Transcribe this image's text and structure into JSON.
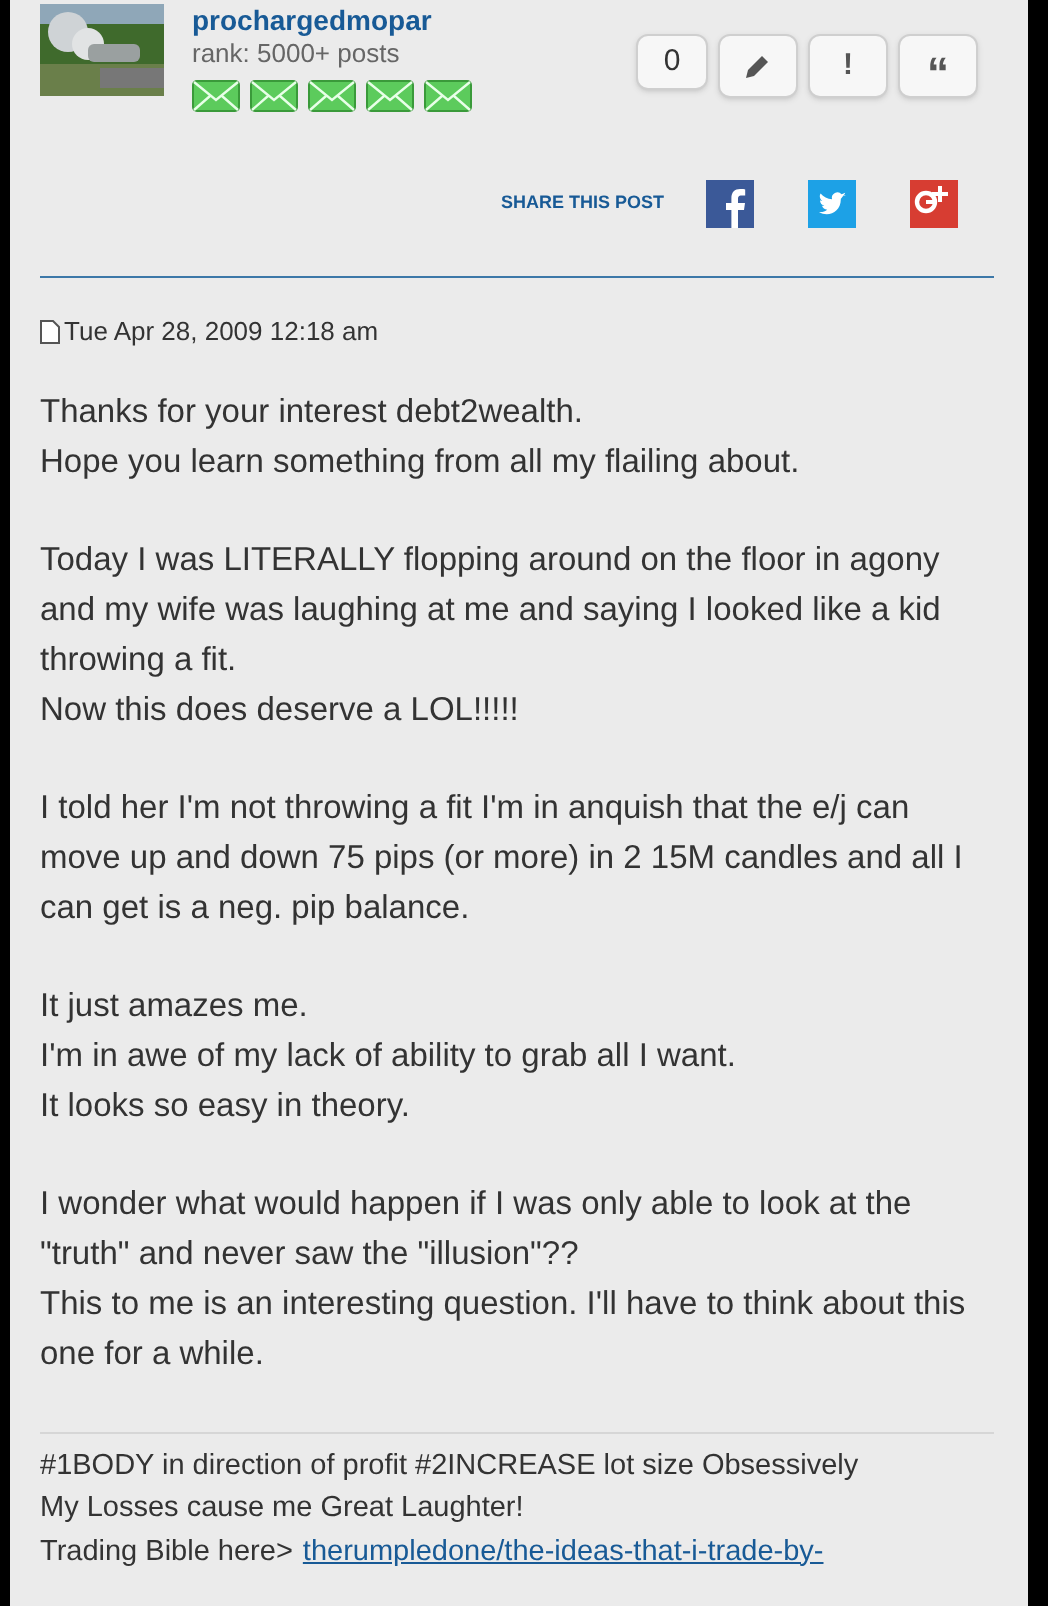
{
  "author": {
    "name": "prochargedmopar",
    "rank": "rank: 5000+ posts",
    "rank_icons": [
      {
        "kind": "envelope"
      },
      {
        "kind": "envelope"
      },
      {
        "kind": "envelope"
      },
      {
        "kind": "envelope"
      },
      {
        "kind": "envelope"
      }
    ]
  },
  "actions": [
    {
      "kind": "count",
      "label": "0"
    },
    {
      "kind": "edit"
    },
    {
      "kind": "report",
      "label": "!"
    },
    {
      "kind": "quote",
      "label": "“"
    }
  ],
  "share": {
    "label": "SHARE THIS POST",
    "networks": [
      {
        "kind": "facebook",
        "color": "#3b5998"
      },
      {
        "kind": "twitter",
        "color": "#1da1e6"
      },
      {
        "kind": "google",
        "color": "#d73d32"
      }
    ]
  },
  "post": {
    "date": "Tue Apr 28, 2009 12:18 am",
    "paragraphs": [
      [
        "Thanks for your interest debt2wealth.",
        "Hope you learn something from all my flailing about."
      ],
      [
        "Today I was LITERALLY flopping around on the floor in agony and my wife was laughing at me and saying I looked like a kid throwing a fit.",
        "Now this does deserve a LOL!!!!!"
      ],
      [
        "I told her I'm not throwing a fit I'm in anquish that the e/j can move up and down 75 pips (or more) in 2 15M candles and all I can get is a neg. pip balance."
      ],
      [
        "It just amazes me.",
        "I'm in awe of my lack of ability to grab all I want.",
        "It looks so easy in theory."
      ],
      [
        "I wonder what would happen if I was only able to look at the \"truth\" and never saw the \"illusion\"??",
        "This to me is an interesting question. I'll have to think about this one for a while."
      ]
    ]
  },
  "signature": {
    "lines": [
      "#1BODY in direction of profit #2INCREASE lot size Obsessively",
      "My Losses cause me Great Laughter!"
    ],
    "link_prefix": "Trading Bible here>",
    "link": "therumpledone/the-ideas-that-i-trade-by-"
  }
}
